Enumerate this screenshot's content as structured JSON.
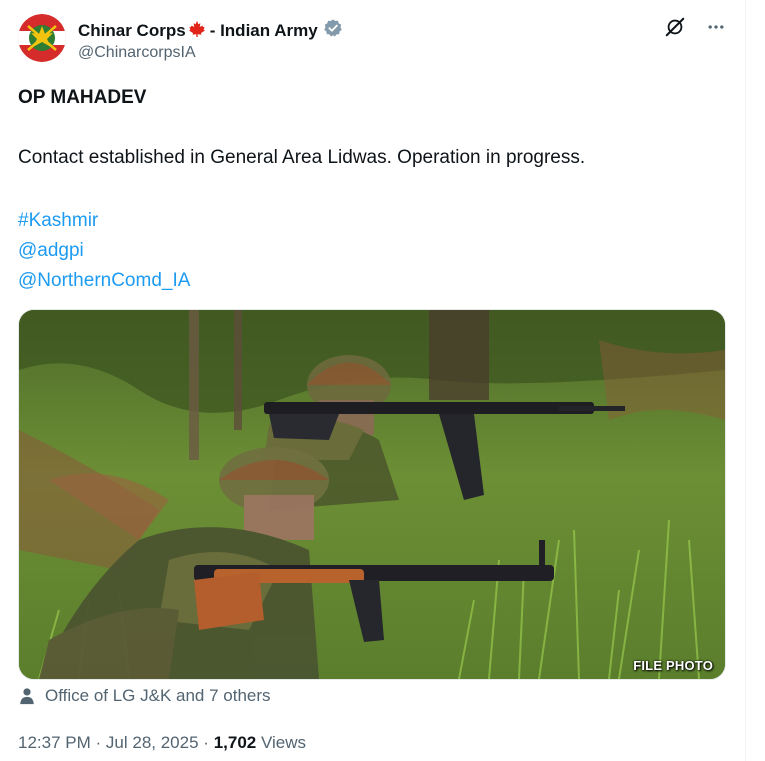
{
  "author": {
    "display_name": "Chinar Corps",
    "name_suffix": " - Indian Army",
    "handle": "@ChinarcorpsIA",
    "flag_icon": "maple-leaf-icon",
    "verified_icon": "verified-badge-icon",
    "verified_color": "#829aab"
  },
  "tweet": {
    "title": "OP MAHADEV",
    "body": "Contact established in General Area Lidwas. Operation in progress.",
    "hashtag": "#Kashmir",
    "mentions": [
      "@adgpi",
      "@NorthernComd_IA"
    ],
    "link_color": "#1d9bf0"
  },
  "media": {
    "overlay_label": "FILE PHOTO"
  },
  "tagged": {
    "text": "Office of LG J&K and 7 others"
  },
  "meta": {
    "time": "12:37 PM",
    "separator": "·",
    "date": "Jul 28, 2025",
    "views_count": "1,702",
    "views_label": "Views"
  },
  "actions": {
    "grok_icon": "grok-icon",
    "more_icon": "more-icon"
  }
}
